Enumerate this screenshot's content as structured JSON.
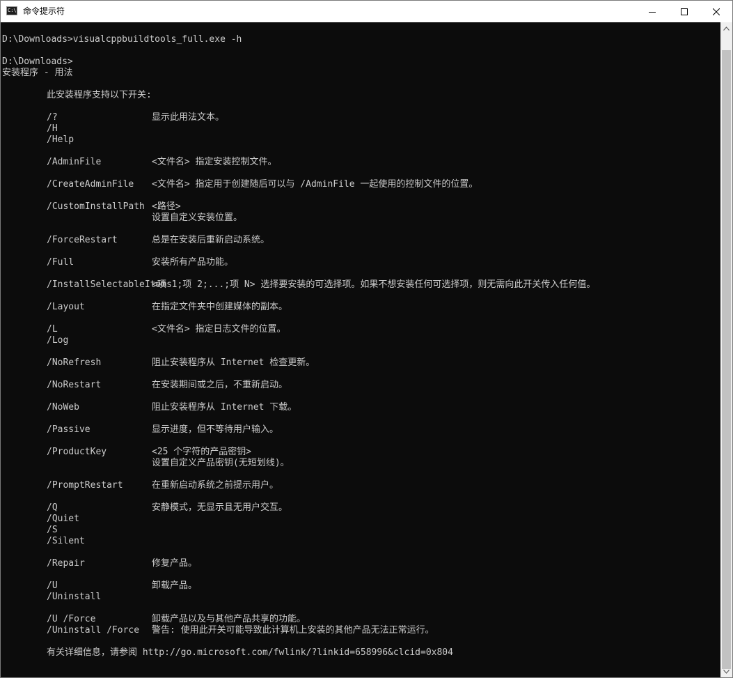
{
  "window": {
    "title": "命令提示符",
    "icon_text": "C:\\"
  },
  "console": {
    "command_line": "D:\\Downloads>visualcppbuildtools_full.exe -h",
    "prompt_line": "D:\\Downloads>",
    "usage_title": "安装程序 - 用法",
    "intro": "此安装程序支持以下开关:",
    "switches": [
      {
        "name": "/?",
        "desc": "显示此用法文本。"
      },
      {
        "name": "/H",
        "desc": ""
      },
      {
        "name": "/Help",
        "desc": ""
      },
      {
        "name": "/AdminFile",
        "desc": "<文件名> 指定安装控制文件。"
      },
      {
        "name": "/CreateAdminFile",
        "desc": "<文件名> 指定用于创建随后可以与 /AdminFile 一起使用的控制文件的位置。"
      },
      {
        "name": "/CustomInstallPath",
        "desc": "<路径>"
      },
      {
        "name": "",
        "desc": "设置自定义安装位置。"
      },
      {
        "name": "/ForceRestart",
        "desc": "总是在安装后重新启动系统。"
      },
      {
        "name": "/Full",
        "desc": "安装所有产品功能。"
      },
      {
        "name": "/InstallSelectableItems",
        "desc": "<项 1;项 2;...;项 N> 选择要安装的可选择项。如果不想安装任何可选择项，则无需向此开关传入任何值。"
      },
      {
        "name": "/Layout",
        "desc": "在指定文件夹中创建媒体的副本。"
      },
      {
        "name": "/L",
        "desc": "<文件名> 指定日志文件的位置。"
      },
      {
        "name": "/Log",
        "desc": ""
      },
      {
        "name": "/NoRefresh",
        "desc": "阻止安装程序从 Internet 检查更新。"
      },
      {
        "name": "/NoRestart",
        "desc": "在安装期间或之后，不重新启动。"
      },
      {
        "name": "/NoWeb",
        "desc": "阻止安装程序从 Internet 下载。"
      },
      {
        "name": "/Passive",
        "desc": "显示进度，但不等待用户输入。"
      },
      {
        "name": "/ProductKey",
        "desc": "<25 个字符的产品密钥>"
      },
      {
        "name": "",
        "desc": "设置自定义产品密钥(无短划线)。"
      },
      {
        "name": "/PromptRestart",
        "desc": "在重新启动系统之前提示用户。"
      },
      {
        "name": "/Q",
        "desc": "安静模式，无显示且无用户交互。"
      },
      {
        "name": "/Quiet",
        "desc": ""
      },
      {
        "name": "/S",
        "desc": ""
      },
      {
        "name": "/Silent",
        "desc": ""
      },
      {
        "name": "/Repair",
        "desc": "修复产品。"
      },
      {
        "name": "/U",
        "desc": "卸载产品。"
      },
      {
        "name": "/Uninstall",
        "desc": ""
      },
      {
        "name": "/U /Force",
        "desc": "卸载产品以及与其他产品共享的功能。"
      },
      {
        "name": "/Uninstall /Force",
        "desc": "警告: 使用此开关可能导致此计算机上安装的其他产品无法正常运行。"
      }
    ],
    "footer": "有关详细信息，请参阅 http://go.microsoft.com/fwlink/?linkid=658996&clcid=0x804"
  }
}
